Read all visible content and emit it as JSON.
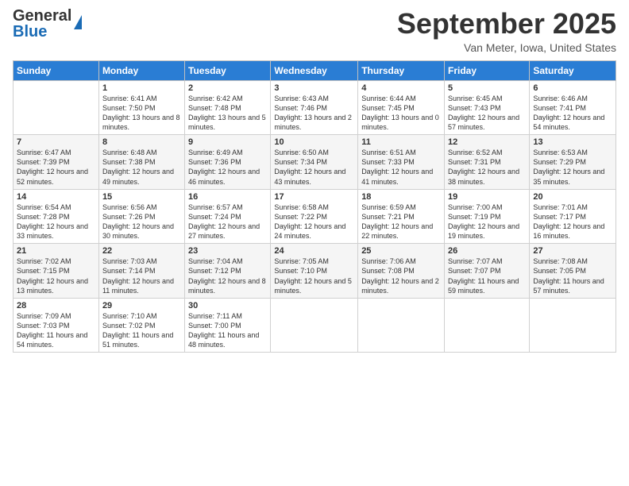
{
  "header": {
    "logo_general": "General",
    "logo_blue": "Blue",
    "month_title": "September 2025",
    "location": "Van Meter, Iowa, United States"
  },
  "days_of_week": [
    "Sunday",
    "Monday",
    "Tuesday",
    "Wednesday",
    "Thursday",
    "Friday",
    "Saturday"
  ],
  "weeks": [
    [
      {
        "day": "",
        "sunrise": "",
        "sunset": "",
        "daylight": ""
      },
      {
        "day": "1",
        "sunrise": "Sunrise: 6:41 AM",
        "sunset": "Sunset: 7:50 PM",
        "daylight": "Daylight: 13 hours and 8 minutes."
      },
      {
        "day": "2",
        "sunrise": "Sunrise: 6:42 AM",
        "sunset": "Sunset: 7:48 PM",
        "daylight": "Daylight: 13 hours and 5 minutes."
      },
      {
        "day": "3",
        "sunrise": "Sunrise: 6:43 AM",
        "sunset": "Sunset: 7:46 PM",
        "daylight": "Daylight: 13 hours and 2 minutes."
      },
      {
        "day": "4",
        "sunrise": "Sunrise: 6:44 AM",
        "sunset": "Sunset: 7:45 PM",
        "daylight": "Daylight: 13 hours and 0 minutes."
      },
      {
        "day": "5",
        "sunrise": "Sunrise: 6:45 AM",
        "sunset": "Sunset: 7:43 PM",
        "daylight": "Daylight: 12 hours and 57 minutes."
      },
      {
        "day": "6",
        "sunrise": "Sunrise: 6:46 AM",
        "sunset": "Sunset: 7:41 PM",
        "daylight": "Daylight: 12 hours and 54 minutes."
      }
    ],
    [
      {
        "day": "7",
        "sunrise": "Sunrise: 6:47 AM",
        "sunset": "Sunset: 7:39 PM",
        "daylight": "Daylight: 12 hours and 52 minutes."
      },
      {
        "day": "8",
        "sunrise": "Sunrise: 6:48 AM",
        "sunset": "Sunset: 7:38 PM",
        "daylight": "Daylight: 12 hours and 49 minutes."
      },
      {
        "day": "9",
        "sunrise": "Sunrise: 6:49 AM",
        "sunset": "Sunset: 7:36 PM",
        "daylight": "Daylight: 12 hours and 46 minutes."
      },
      {
        "day": "10",
        "sunrise": "Sunrise: 6:50 AM",
        "sunset": "Sunset: 7:34 PM",
        "daylight": "Daylight: 12 hours and 43 minutes."
      },
      {
        "day": "11",
        "sunrise": "Sunrise: 6:51 AM",
        "sunset": "Sunset: 7:33 PM",
        "daylight": "Daylight: 12 hours and 41 minutes."
      },
      {
        "day": "12",
        "sunrise": "Sunrise: 6:52 AM",
        "sunset": "Sunset: 7:31 PM",
        "daylight": "Daylight: 12 hours and 38 minutes."
      },
      {
        "day": "13",
        "sunrise": "Sunrise: 6:53 AM",
        "sunset": "Sunset: 7:29 PM",
        "daylight": "Daylight: 12 hours and 35 minutes."
      }
    ],
    [
      {
        "day": "14",
        "sunrise": "Sunrise: 6:54 AM",
        "sunset": "Sunset: 7:28 PM",
        "daylight": "Daylight: 12 hours and 33 minutes."
      },
      {
        "day": "15",
        "sunrise": "Sunrise: 6:56 AM",
        "sunset": "Sunset: 7:26 PM",
        "daylight": "Daylight: 12 hours and 30 minutes."
      },
      {
        "day": "16",
        "sunrise": "Sunrise: 6:57 AM",
        "sunset": "Sunset: 7:24 PM",
        "daylight": "Daylight: 12 hours and 27 minutes."
      },
      {
        "day": "17",
        "sunrise": "Sunrise: 6:58 AM",
        "sunset": "Sunset: 7:22 PM",
        "daylight": "Daylight: 12 hours and 24 minutes."
      },
      {
        "day": "18",
        "sunrise": "Sunrise: 6:59 AM",
        "sunset": "Sunset: 7:21 PM",
        "daylight": "Daylight: 12 hours and 22 minutes."
      },
      {
        "day": "19",
        "sunrise": "Sunrise: 7:00 AM",
        "sunset": "Sunset: 7:19 PM",
        "daylight": "Daylight: 12 hours and 19 minutes."
      },
      {
        "day": "20",
        "sunrise": "Sunrise: 7:01 AM",
        "sunset": "Sunset: 7:17 PM",
        "daylight": "Daylight: 12 hours and 16 minutes."
      }
    ],
    [
      {
        "day": "21",
        "sunrise": "Sunrise: 7:02 AM",
        "sunset": "Sunset: 7:15 PM",
        "daylight": "Daylight: 12 hours and 13 minutes."
      },
      {
        "day": "22",
        "sunrise": "Sunrise: 7:03 AM",
        "sunset": "Sunset: 7:14 PM",
        "daylight": "Daylight: 12 hours and 11 minutes."
      },
      {
        "day": "23",
        "sunrise": "Sunrise: 7:04 AM",
        "sunset": "Sunset: 7:12 PM",
        "daylight": "Daylight: 12 hours and 8 minutes."
      },
      {
        "day": "24",
        "sunrise": "Sunrise: 7:05 AM",
        "sunset": "Sunset: 7:10 PM",
        "daylight": "Daylight: 12 hours and 5 minutes."
      },
      {
        "day": "25",
        "sunrise": "Sunrise: 7:06 AM",
        "sunset": "Sunset: 7:08 PM",
        "daylight": "Daylight: 12 hours and 2 minutes."
      },
      {
        "day": "26",
        "sunrise": "Sunrise: 7:07 AM",
        "sunset": "Sunset: 7:07 PM",
        "daylight": "Daylight: 11 hours and 59 minutes."
      },
      {
        "day": "27",
        "sunrise": "Sunrise: 7:08 AM",
        "sunset": "Sunset: 7:05 PM",
        "daylight": "Daylight: 11 hours and 57 minutes."
      }
    ],
    [
      {
        "day": "28",
        "sunrise": "Sunrise: 7:09 AM",
        "sunset": "Sunset: 7:03 PM",
        "daylight": "Daylight: 11 hours and 54 minutes."
      },
      {
        "day": "29",
        "sunrise": "Sunrise: 7:10 AM",
        "sunset": "Sunset: 7:02 PM",
        "daylight": "Daylight: 11 hours and 51 minutes."
      },
      {
        "day": "30",
        "sunrise": "Sunrise: 7:11 AM",
        "sunset": "Sunset: 7:00 PM",
        "daylight": "Daylight: 11 hours and 48 minutes."
      },
      {
        "day": "",
        "sunrise": "",
        "sunset": "",
        "daylight": ""
      },
      {
        "day": "",
        "sunrise": "",
        "sunset": "",
        "daylight": ""
      },
      {
        "day": "",
        "sunrise": "",
        "sunset": "",
        "daylight": ""
      },
      {
        "day": "",
        "sunrise": "",
        "sunset": "",
        "daylight": ""
      }
    ]
  ]
}
